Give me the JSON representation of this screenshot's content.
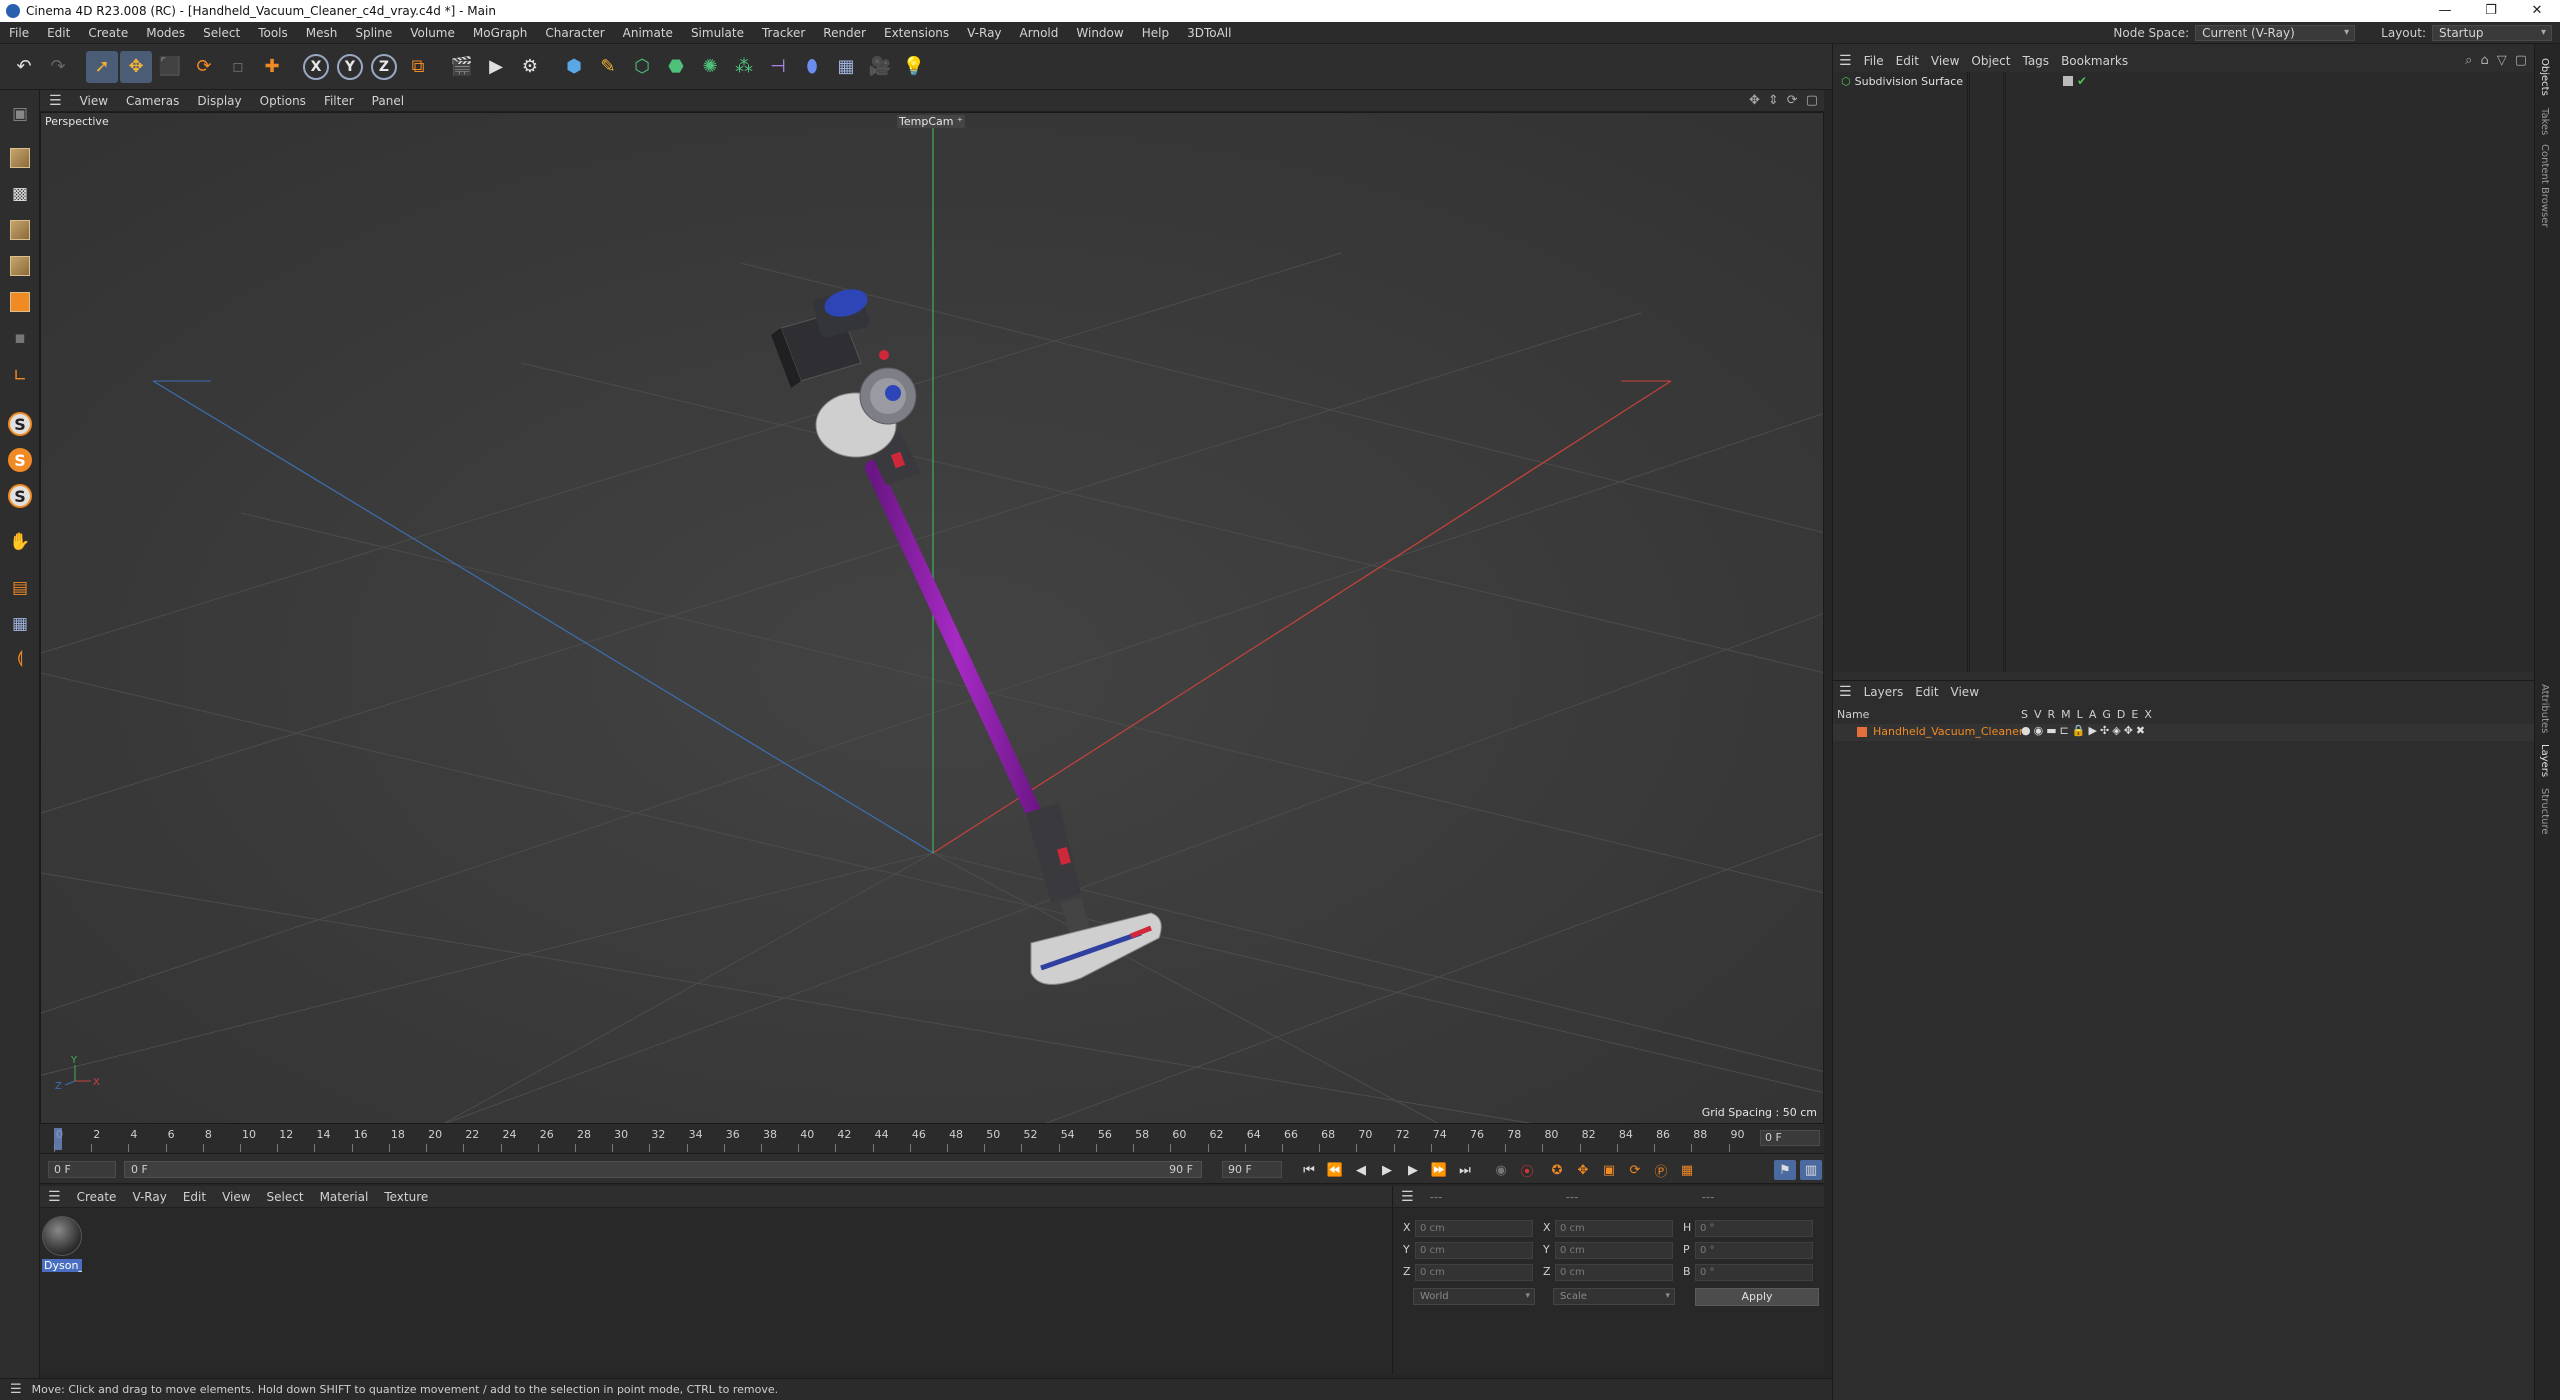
{
  "window": {
    "title": "Cinema 4D R23.008 (RC) - [Handheld_Vacuum_Cleaner_c4d_vray.c4d *] - Main",
    "minimize": "—",
    "maximize": "❐",
    "close": "✕"
  },
  "menubar": {
    "items": [
      "File",
      "Edit",
      "Create",
      "Modes",
      "Select",
      "Tools",
      "Mesh",
      "Spline",
      "Volume",
      "MoGraph",
      "Character",
      "Animate",
      "Simulate",
      "Tracker",
      "Render",
      "Extensions",
      "V-Ray",
      "Arnold",
      "Window",
      "Help",
      "3DToAll"
    ],
    "node_space_label": "Node Space:",
    "node_space_value": "Current (V-Ray)",
    "layout_label": "Layout:",
    "layout_value": "Startup"
  },
  "viewport": {
    "menu": [
      "View",
      "Cameras",
      "Display",
      "Options",
      "Filter",
      "Panel"
    ],
    "view_name": "Perspective",
    "camera_tag": "TempCam ⁺",
    "grid_spacing": "Grid Spacing : 50 cm",
    "axis_x": "X",
    "axis_y": "Y",
    "axis_z": "Z"
  },
  "timeline": {
    "ticks": [
      "0",
      "2",
      "4",
      "6",
      "8",
      "10",
      "12",
      "14",
      "16",
      "18",
      "20",
      "22",
      "24",
      "26",
      "28",
      "30",
      "32",
      "34",
      "36",
      "38",
      "40",
      "42",
      "44",
      "46",
      "48",
      "50",
      "52",
      "54",
      "56",
      "58",
      "60",
      "62",
      "64",
      "66",
      "68",
      "70",
      "72",
      "74",
      "76",
      "78",
      "80",
      "82",
      "84",
      "86",
      "88",
      "90"
    ],
    "current_frame": "0 F",
    "start_field": "0 F",
    "slider_left": "0 F",
    "slider_right": "90 F",
    "end_field": "90 F"
  },
  "materials": {
    "menu": [
      "Create",
      "V-Ray",
      "Edit",
      "View",
      "Select",
      "Material",
      "Texture"
    ],
    "items": [
      {
        "name": "Dyson_V"
      }
    ]
  },
  "coordinates": {
    "menu": [
      "---",
      "---",
      "---"
    ],
    "pos_x": "0 cm",
    "pos_y": "0 cm",
    "pos_z": "0 cm",
    "size_x": "0 cm",
    "size_y": "0 cm",
    "size_z": "0 cm",
    "rot_h": "0 °",
    "rot_p": "0 °",
    "rot_b": "0 °",
    "label_x": "X",
    "label_y": "Y",
    "label_z": "Z",
    "label_h": "H",
    "label_p": "P",
    "label_b": "B",
    "mode": "World",
    "scale": "Scale",
    "apply": "Apply"
  },
  "status": "Move: Click and drag to move elements. Hold down SHIFT to quantize movement / add to the selection in point mode, CTRL to remove.",
  "objects": {
    "menu": [
      "File",
      "Edit",
      "View",
      "Object",
      "Tags",
      "Bookmarks"
    ],
    "items": [
      {
        "name": "Subdivision Surface"
      }
    ]
  },
  "layers": {
    "menu": [
      "Layers",
      "Edit",
      "View"
    ],
    "header_name": "Name",
    "header_flags": [
      "S",
      "V",
      "R",
      "M",
      "L",
      "A",
      "G",
      "D",
      "E",
      "X"
    ],
    "items": [
      {
        "name": "Handheld_Vacuum_Cleaner",
        "color": "#e3703a"
      }
    ]
  },
  "side_tabs": [
    "Objects",
    "Takes",
    "Content Browser",
    "Attributes",
    "Layers",
    "Structure"
  ],
  "colors": {
    "accent_blue": "#4b6aa0",
    "accent_orange": "#f08a24",
    "vacuum_purple": "#8b1fa8",
    "axis_red": "#c8423a",
    "axis_blue": "#3c6fb0",
    "axis_green": "#3fae5a"
  }
}
